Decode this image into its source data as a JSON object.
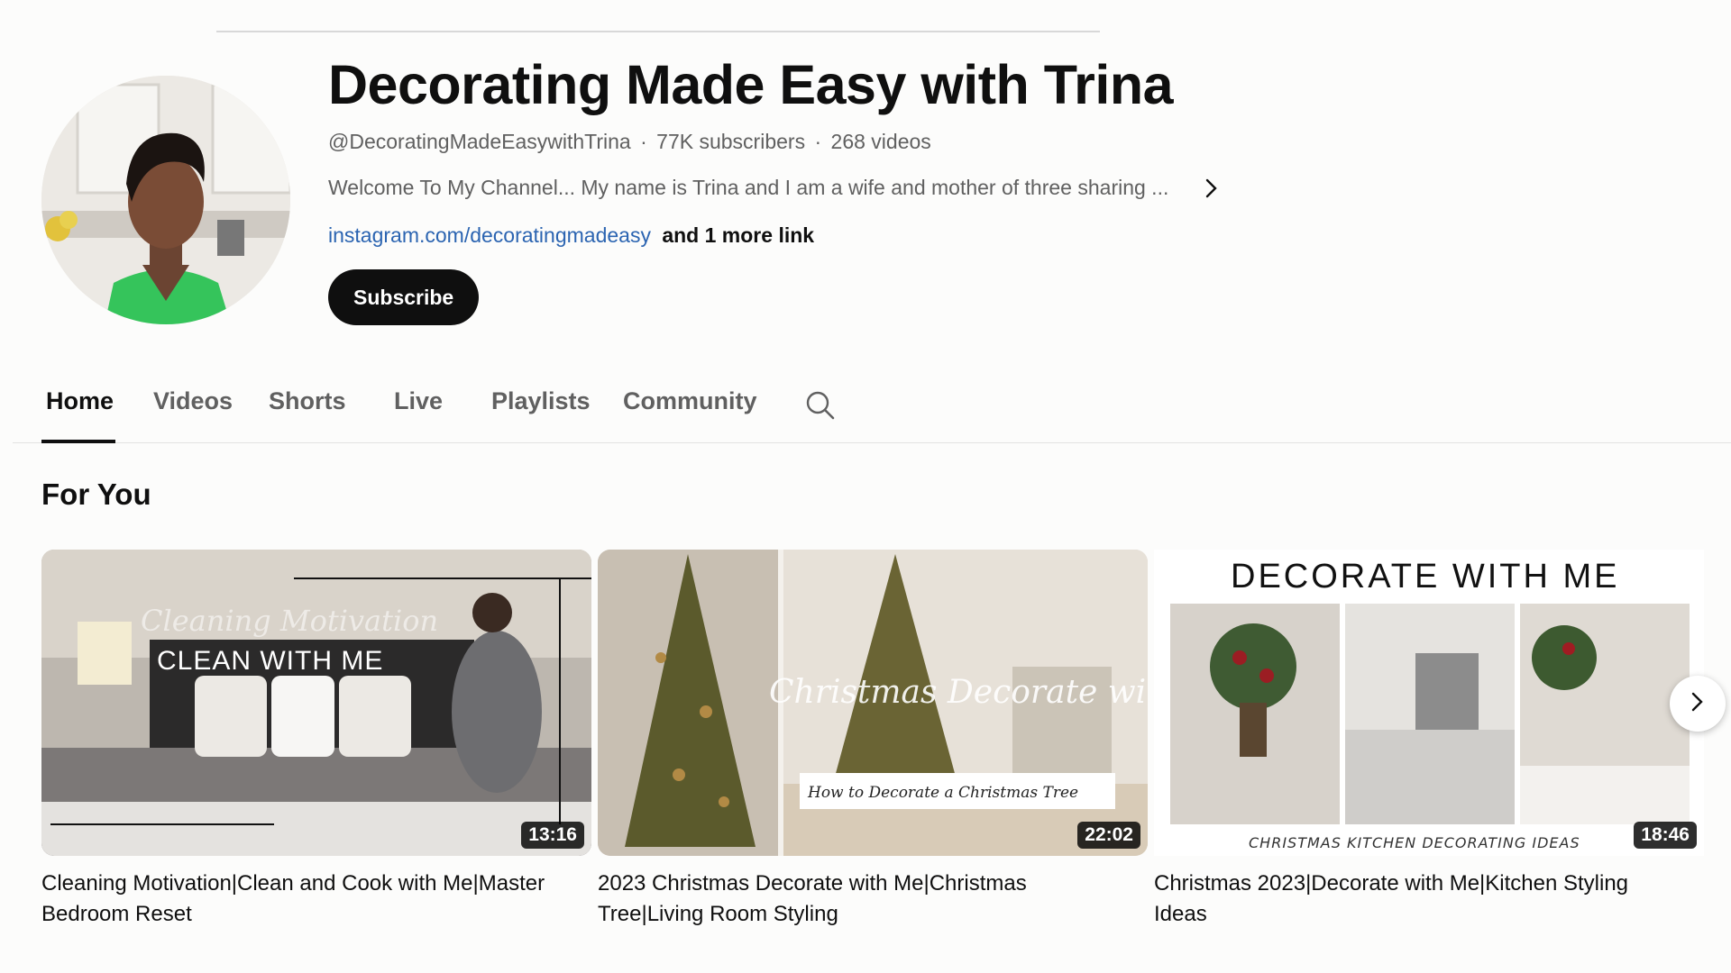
{
  "channel": {
    "title": "Decorating Made Easy with Trina",
    "handle": "@DecoratingMadeEasywithTrina",
    "subscribers": "77K subscribers",
    "videos": "268 videos",
    "meta_separator": "·",
    "description": "Welcome To My Channel... My name is Trina and I am a wife and mother of three sharing ...",
    "link": "instagram.com/decoratingmadeasy",
    "more_links": "and 1 more link",
    "subscribe_label": "Subscribe"
  },
  "tabs": [
    {
      "label": "Home",
      "active": true
    },
    {
      "label": "Videos",
      "active": false
    },
    {
      "label": "Shorts",
      "active": false
    },
    {
      "label": "Live",
      "active": false
    },
    {
      "label": "Playlists",
      "active": false
    },
    {
      "label": "Community",
      "active": false
    }
  ],
  "tab_search_icon": "search-icon",
  "section": {
    "title": "For You"
  },
  "videos": [
    {
      "title": "Cleaning Motivation|Clean and Cook with Me|Master Bedroom Reset",
      "duration": "13:16",
      "thumb_script": "Cleaning Motivation",
      "thumb_caption": "CLEAN WITH ME"
    },
    {
      "title": "2023 Christmas Decorate with Me|Christmas Tree|Living Room Styling",
      "duration": "22:02",
      "thumb_script": "Christmas Decorate with Me",
      "thumb_caption": "How to Decorate a Christmas Tree"
    },
    {
      "title": "Christmas 2023|Decorate with Me|Kitchen Styling Ideas",
      "duration": "18:46",
      "thumb_heading": "DECORATE WITH ME",
      "thumb_caption": "CHRISTMAS KITCHEN DECORATING IDEAS"
    }
  ],
  "colors": {
    "background": "#fcfcfb",
    "text_primary": "#0f0f0f",
    "text_secondary": "#606060",
    "link": "#2b64b1",
    "subscribe_bg": "#0f0f0f"
  },
  "icons": {
    "description_expand": "chevron-right-icon",
    "carousel_next": "chevron-right-icon"
  }
}
